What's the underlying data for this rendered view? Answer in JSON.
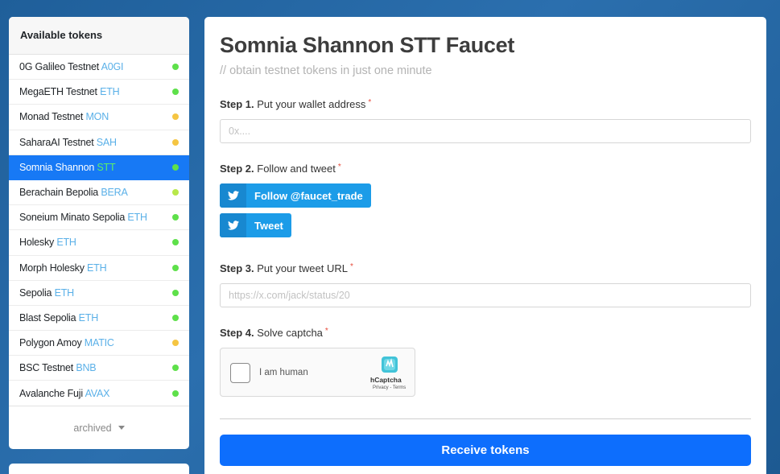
{
  "sidebar": {
    "header": "Available tokens",
    "items": [
      {
        "name": "0G Galileo Testnet",
        "symbol": "A0GI",
        "status_color": "#5ee04a"
      },
      {
        "name": "MegaETH Testnet",
        "symbol": "ETH",
        "status_color": "#5ee04a"
      },
      {
        "name": "Monad Testnet",
        "symbol": "MON",
        "status_color": "#f5c542"
      },
      {
        "name": "SaharaAI Testnet",
        "symbol": "SAH",
        "status_color": "#f5c542"
      },
      {
        "name": "Somnia Shannon",
        "symbol": "STT",
        "status_color": "#5ee04a",
        "active": true
      },
      {
        "name": "Berachain Bepolia",
        "symbol": "BERA",
        "status_color": "#b8e84a"
      },
      {
        "name": "Soneium Minato Sepolia",
        "symbol": "ETH",
        "status_color": "#5ee04a"
      },
      {
        "name": "Holesky",
        "symbol": "ETH",
        "status_color": "#5ee04a"
      },
      {
        "name": "Morph Holesky",
        "symbol": "ETH",
        "status_color": "#5ee04a"
      },
      {
        "name": "Sepolia",
        "symbol": "ETH",
        "status_color": "#5ee04a"
      },
      {
        "name": "Blast Sepolia",
        "symbol": "ETH",
        "status_color": "#5ee04a"
      },
      {
        "name": "Polygon Amoy",
        "symbol": "MATIC",
        "status_color": "#f5c542"
      },
      {
        "name": "BSC Testnet",
        "symbol": "BNB",
        "status_color": "#5ee04a"
      },
      {
        "name": "Avalanche Fuji",
        "symbol": "AVAX",
        "status_color": "#5ee04a"
      }
    ],
    "archived_label": "archived"
  },
  "main": {
    "title": "Somnia Shannon STT Faucet",
    "subtitle": "// obtain testnet tokens in just one minute",
    "step1": {
      "num": "Step 1.",
      "text": "Put your wallet address",
      "req": "*",
      "placeholder": "0x...."
    },
    "step2": {
      "num": "Step 2.",
      "text": "Follow and tweet",
      "req": "*",
      "follow_label": "Follow @faucet_trade",
      "tweet_label": "Tweet"
    },
    "step3": {
      "num": "Step 3.",
      "text": "Put your tweet URL",
      "req": "*",
      "placeholder": "https://x.com/jack/status/20"
    },
    "step4": {
      "num": "Step 4.",
      "text": "Solve captcha",
      "req": "*"
    },
    "captcha": {
      "label": "I am human",
      "brand": "hCaptcha",
      "links": "Privacy - Terms"
    },
    "submit_label": "Receive tokens"
  },
  "icons": {
    "twitter": "twitter-icon",
    "caret": "caret-down-icon",
    "captcha_logo": "hcaptcha-logo"
  }
}
